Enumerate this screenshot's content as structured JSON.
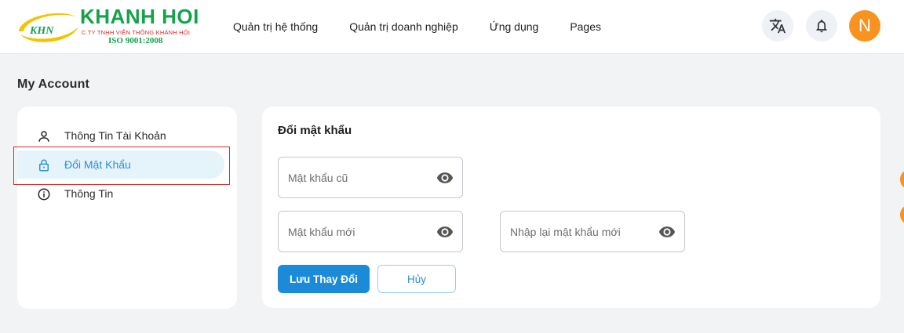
{
  "header": {
    "logo": {
      "mark": "KHN",
      "name": "KHANH HOI",
      "company": "C.TY TNHH VIỄN THÔNG KHÁNH HỘI",
      "iso": "ISO 9001:2008"
    },
    "nav": [
      {
        "label": "Quản trị hệ thống"
      },
      {
        "label": "Quản trị doanh nghiệp"
      },
      {
        "label": "Ứng dụng"
      },
      {
        "label": "Pages"
      }
    ],
    "avatar_initial": "N"
  },
  "page_title": "My Account",
  "sidebar": {
    "items": [
      {
        "label": "Thông Tin Tài Khoản",
        "icon": "user-icon"
      },
      {
        "label": "Đổi Mật Khẩu",
        "icon": "lock-icon",
        "active": true
      },
      {
        "label": "Thông Tin",
        "icon": "info-icon"
      }
    ]
  },
  "form": {
    "title": "Đổi mật khẩu",
    "old_password": {
      "placeholder": "Mật khẩu cũ",
      "value": ""
    },
    "new_password": {
      "placeholder": "Mật khẩu mới",
      "value": ""
    },
    "confirm_password": {
      "placeholder": "Nhập lại mật khẩu mới",
      "value": ""
    },
    "save_label": "Lưu Thay Đổi",
    "cancel_label": "Hủy"
  },
  "colors": {
    "brand_green": "#14a24a",
    "primary_blue": "#1b8ad8",
    "avatar_orange": "#f7931e",
    "active_bg": "#e5f3fb"
  }
}
